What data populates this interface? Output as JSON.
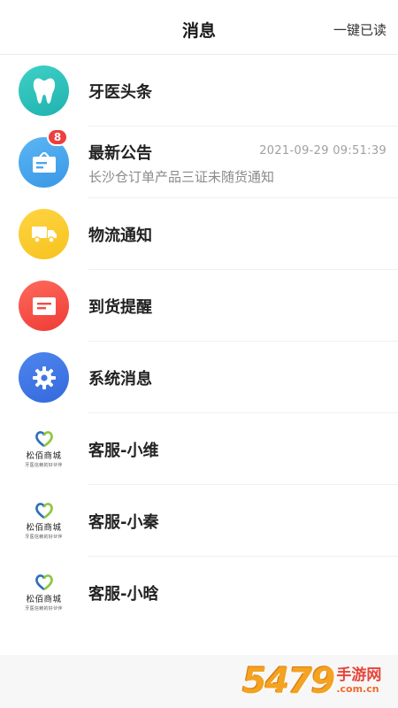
{
  "header": {
    "title": "消息",
    "action_label": "一键已读"
  },
  "messages": [
    {
      "title": "牙医头条",
      "icon": "tooth-icon",
      "color": "#2cc3bd"
    },
    {
      "title": "最新公告",
      "icon": "announcement-icon",
      "color": "#4aa7ee",
      "subtitle": "长沙仓订单产品三证未随货通知",
      "time": "2021-09-29 09:51:39",
      "badge": "8"
    },
    {
      "title": "物流通知",
      "icon": "truck-icon",
      "color": "#fbcb2e"
    },
    {
      "title": "到货提醒",
      "icon": "arrival-card-icon",
      "color": "#f24d45"
    },
    {
      "title": "系统消息",
      "icon": "gear-icon",
      "color": "#3f78e6"
    },
    {
      "title": "客服-小维",
      "icon": "store-logo-icon",
      "logo_text": "松佰商城",
      "logo_tag": "牙医信赖的好伙伴"
    },
    {
      "title": "客服-小秦",
      "icon": "store-logo-icon",
      "logo_text": "松佰商城",
      "logo_tag": "牙医信赖的好伙伴"
    },
    {
      "title": "客服-小晗",
      "icon": "store-logo-icon",
      "logo_text": "松佰商城",
      "logo_tag": "牙医信赖的好伙伴"
    }
  ],
  "watermark": {
    "number": "5479",
    "name": "手游网",
    "domain": ".com.cn"
  }
}
